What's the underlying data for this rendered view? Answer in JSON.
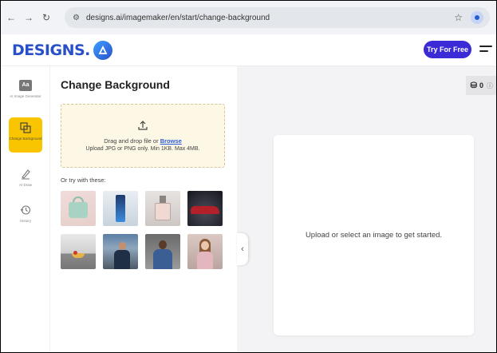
{
  "browser": {
    "url": "designs.ai/imagemaker/en/start/change-background"
  },
  "header": {
    "logo_text": "DESIGNS.",
    "try_button": "Try For Free"
  },
  "sidebar": {
    "items": [
      {
        "label": "AI Image Generator",
        "icon": "aa-icon",
        "active": false
      },
      {
        "label": "Change Background",
        "icon": "images-icon",
        "active": true
      },
      {
        "label": "AI Draw",
        "icon": "pen-icon",
        "active": false
      },
      {
        "label": "History",
        "icon": "history-icon",
        "active": false
      }
    ]
  },
  "panel": {
    "title": "Change Background",
    "dropzone_text": "Drag and drop file or",
    "dropzone_link": "Browse",
    "dropzone_hint": "Upload JPG or PNG only. Min 1KB. Max 4MB.",
    "samples_label": "Or try with these:",
    "samples": [
      "handbag",
      "smartphone",
      "perfume",
      "red-car",
      "kitchen-fruit-bowl",
      "man-mountains",
      "man-jacket",
      "woman-street"
    ]
  },
  "canvas": {
    "credits_value": "0",
    "placeholder": "Upload or select an image to get started."
  },
  "colors": {
    "brand_blue": "#2950c9",
    "try_button": "#3b2bd6",
    "active_yellow": "#f9c400",
    "dropzone_bg": "#fdf7e5"
  }
}
